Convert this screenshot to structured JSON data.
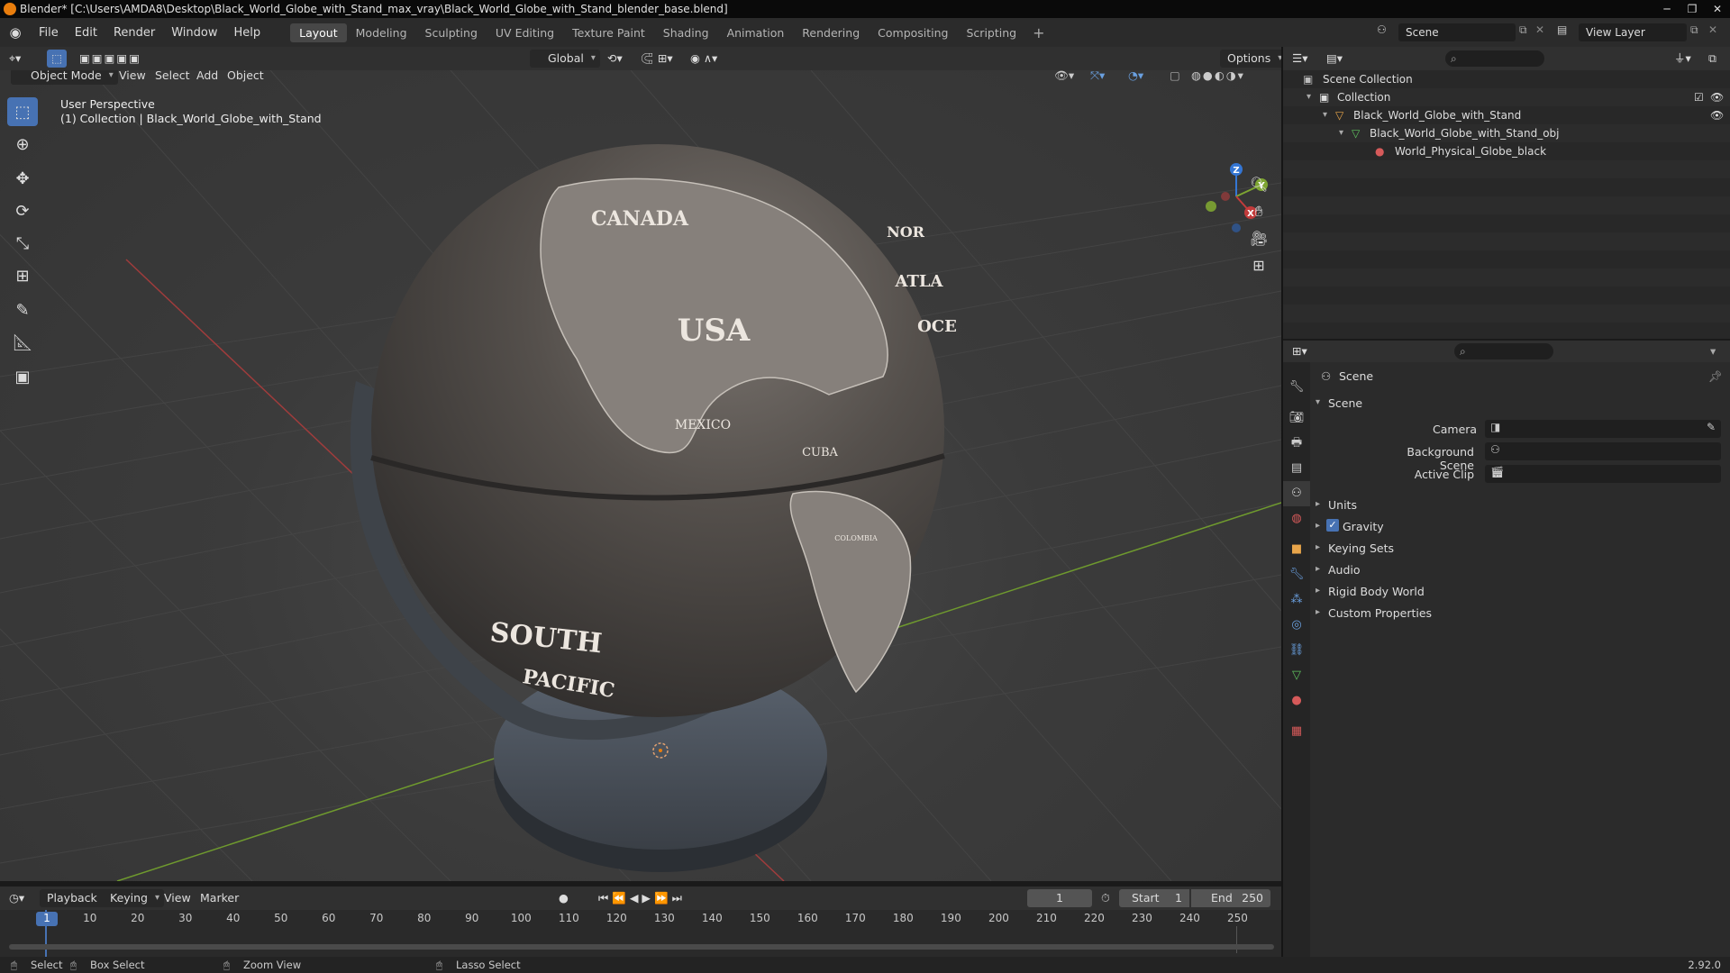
{
  "window": {
    "title": "Blender* [C:\\Users\\AMDA8\\Desktop\\Black_World_Globe_with_Stand_max_vray\\Black_World_Globe_with_Stand_blender_base.blend]"
  },
  "menu": [
    "File",
    "Edit",
    "Render",
    "Window",
    "Help"
  ],
  "workspaces": [
    "Layout",
    "Modeling",
    "Sculpting",
    "UV Editing",
    "Texture Paint",
    "Shading",
    "Animation",
    "Rendering",
    "Compositing",
    "Scripting"
  ],
  "active_workspace": "Layout",
  "scene_field": "Scene",
  "view_layer_field": "View Layer",
  "viewport_header": {
    "transform_orientation": "Global",
    "options": "Options",
    "mode": "Object Mode",
    "menus": [
      "View",
      "Select",
      "Add",
      "Object"
    ]
  },
  "viewport_overlay": {
    "line1": "User Perspective",
    "line2": "(1) Collection | Black_World_Globe_with_Stand"
  },
  "globe_labels": [
    "CANADA",
    "USA",
    "MEXICO",
    "CUBA",
    "COLOMBIA",
    "SOUTH",
    "PACIFIC",
    "ATLA",
    "NOR",
    "OCE"
  ],
  "gizmo_axes": {
    "z": "Z",
    "y": "Y",
    "x": "X"
  },
  "outliner": {
    "items": [
      "Scene Collection",
      "Collection",
      "Black_World_Globe_with_Stand",
      "Black_World_Globe_with_Stand_obj",
      "World_Physical_Globe_black"
    ]
  },
  "properties": {
    "context": "Scene",
    "panel": "Scene",
    "camera_label": "Camera",
    "background_scene_label": "Background Scene",
    "active_clip_label": "Active Clip",
    "sections": [
      "Units",
      "Gravity",
      "Keying Sets",
      "Audio",
      "Rigid Body World",
      "Custom Properties"
    ]
  },
  "timeline": {
    "menus": [
      "Playback",
      "Keying",
      "View",
      "Marker"
    ],
    "current_frame": "1",
    "start_label": "Start",
    "start": "1",
    "end_label": "End",
    "end": "250",
    "ticks": [
      "1",
      "10",
      "20",
      "30",
      "40",
      "50",
      "60",
      "70",
      "80",
      "90",
      "100",
      "110",
      "120",
      "130",
      "140",
      "150",
      "160",
      "170",
      "180",
      "190",
      "200",
      "210",
      "220",
      "230",
      "240",
      "250"
    ]
  },
  "statusbar": {
    "select": "Select",
    "box_select": "Box Select",
    "zoom_view": "Zoom View",
    "lasso_select": "Lasso Select",
    "version": "2.92.0"
  },
  "colors": {
    "accent": "#4772b3",
    "x_axis": "#c23b3b",
    "y_axis": "#7ea532",
    "z_axis": "#3476d4",
    "blender_orange": "#e87d0d"
  }
}
